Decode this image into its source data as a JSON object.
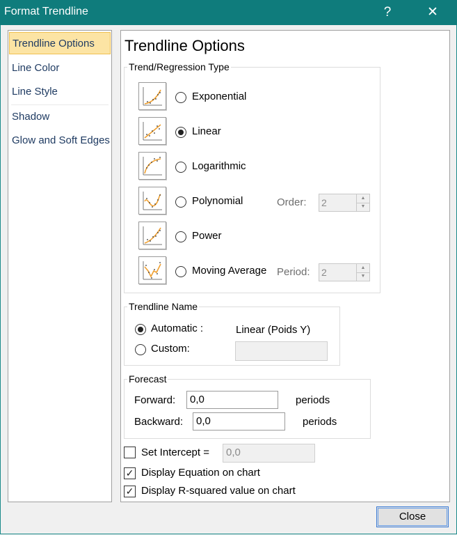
{
  "window": {
    "title": "Format Trendline",
    "help_glyph": "?",
    "close_glyph": "✕"
  },
  "nav": {
    "items": [
      {
        "label": "Trendline Options",
        "selected": true
      },
      {
        "label": "Line Color",
        "selected": false
      },
      {
        "label": "Line Style",
        "selected": false
      },
      {
        "label": "Shadow",
        "selected": false
      },
      {
        "label": "Glow and Soft Edges",
        "selected": false
      }
    ]
  },
  "panel": {
    "title": "Trendline Options",
    "trend_group": {
      "label": "Trend/Regression Type",
      "types": [
        {
          "label": "Exponential",
          "mnemonic": "x",
          "icon": "exponential-trend-icon",
          "selected": false
        },
        {
          "label": "Linear",
          "mnemonic": "L",
          "icon": "linear-trend-icon",
          "selected": true
        },
        {
          "label": "Logarithmic",
          "mnemonic": "o",
          "icon": "logarithmic-trend-icon",
          "selected": false
        },
        {
          "label": "Polynomial",
          "mnemonic": "P",
          "icon": "polynomial-trend-icon",
          "selected": false
        },
        {
          "label": "Power",
          "mnemonic": "w",
          "icon": "power-trend-icon",
          "selected": false
        },
        {
          "label": "Moving Average",
          "mnemonic": "M",
          "icon": "moving-average-trend-icon",
          "selected": false
        }
      ],
      "order": {
        "label": "Order:",
        "value": "2"
      },
      "period": {
        "label": "Period:",
        "value": "2"
      }
    },
    "name_group": {
      "label": "Trendline Name",
      "automatic_label": "Automatic :",
      "automatic_value": "Linear (Poids Y)",
      "custom_label": "Custom:",
      "custom_value": "",
      "selected": "automatic"
    },
    "forecast_group": {
      "label": "Forecast",
      "forward_label": "Forward:",
      "forward_value": "0,0",
      "backward_label": "Backward:",
      "backward_value": "0,0",
      "units": "periods"
    },
    "options": {
      "set_intercept": {
        "label": "Set Intercept =",
        "checked": false,
        "value": "0,0"
      },
      "display_equation": {
        "label": "Display Equation on chart",
        "checked": true
      },
      "display_r_squared": {
        "label": "Display R-squared value on chart",
        "checked": true
      }
    }
  },
  "footer": {
    "close_label": "Close"
  },
  "colors": {
    "titlebar": "#0f7c7c",
    "nav_selected": "#fce4a4",
    "nav_text": "#1f3b62",
    "icon_line": "#f0a030"
  }
}
